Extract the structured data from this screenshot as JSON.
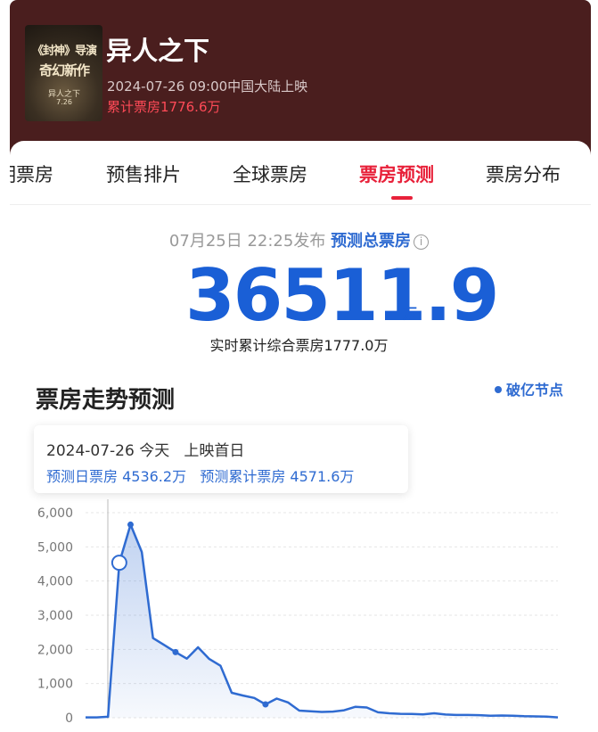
{
  "movie": {
    "title": "异人之下",
    "release": "2024-07-26 09:00中国大陆上映",
    "cumulative_box": "累计票房1776.6万",
    "poster_text": [
      "《封神》导演",
      "奇幻新作",
      "异人之下",
      "7.26"
    ]
  },
  "tabs": [
    {
      "label": "明票房",
      "active": false
    },
    {
      "label": "预售排片",
      "active": false
    },
    {
      "label": "全球票房",
      "active": false
    },
    {
      "label": "票房预测",
      "active": true
    },
    {
      "label": "票房分布",
      "active": false
    }
  ],
  "forecast": {
    "publish_time": "07月25日 22:25发布",
    "label": "预测总票房",
    "info_icon": "info-icon",
    "value": "36511.9",
    "unit": "万",
    "realtime": "实时累计综合票房1777.0万"
  },
  "trend": {
    "title": "票房走势预测",
    "legend": "破亿节点",
    "tooltip": {
      "date": "2024-07-26",
      "today": "今天",
      "day": "上映首日",
      "daily": "预测日票房 4536.2万",
      "cumulative": "预测累计票房 4571.6万"
    }
  },
  "colors": {
    "header_bg": "#4a1e1e",
    "accent_red": "#e8213a",
    "accent_blue": "#1a5fd6",
    "line": "#2f6bd1"
  },
  "chart_data": {
    "type": "area",
    "y_ticks": [
      "6,000",
      "5,000",
      "4,000",
      "3,000",
      "2,000",
      "1,000",
      "0"
    ],
    "ylim": [
      0,
      6000
    ],
    "xlim": [
      -2,
      40
    ],
    "highlight_index": 1,
    "series": [
      {
        "values": [
          [
            -2,
            10
          ],
          [
            -1,
            10
          ],
          [
            0,
            30
          ],
          [
            1,
            4536
          ],
          [
            2,
            5650
          ],
          [
            3,
            4850
          ],
          [
            4,
            2330
          ],
          [
            5,
            2130
          ],
          [
            6,
            1920
          ],
          [
            7,
            1730
          ],
          [
            8,
            2060
          ],
          [
            9,
            1720
          ],
          [
            10,
            1520
          ],
          [
            11,
            730
          ],
          [
            12,
            650
          ],
          [
            13,
            580
          ],
          [
            14,
            390
          ],
          [
            15,
            560
          ],
          [
            16,
            450
          ],
          [
            17,
            210
          ],
          [
            18,
            190
          ],
          [
            19,
            170
          ],
          [
            20,
            180
          ],
          [
            21,
            220
          ],
          [
            22,
            320
          ],
          [
            23,
            300
          ],
          [
            24,
            160
          ],
          [
            25,
            130
          ],
          [
            26,
            115
          ],
          [
            27,
            110
          ],
          [
            28,
            100
          ],
          [
            29,
            130
          ],
          [
            30,
            95
          ],
          [
            31,
            80
          ],
          [
            32,
            80
          ],
          [
            33,
            75
          ],
          [
            34,
            60
          ],
          [
            35,
            65
          ],
          [
            36,
            60
          ],
          [
            37,
            45
          ],
          [
            38,
            40
          ],
          [
            39,
            35
          ],
          [
            40,
            10
          ]
        ],
        "markers": [
          2,
          6,
          14
        ]
      }
    ]
  }
}
